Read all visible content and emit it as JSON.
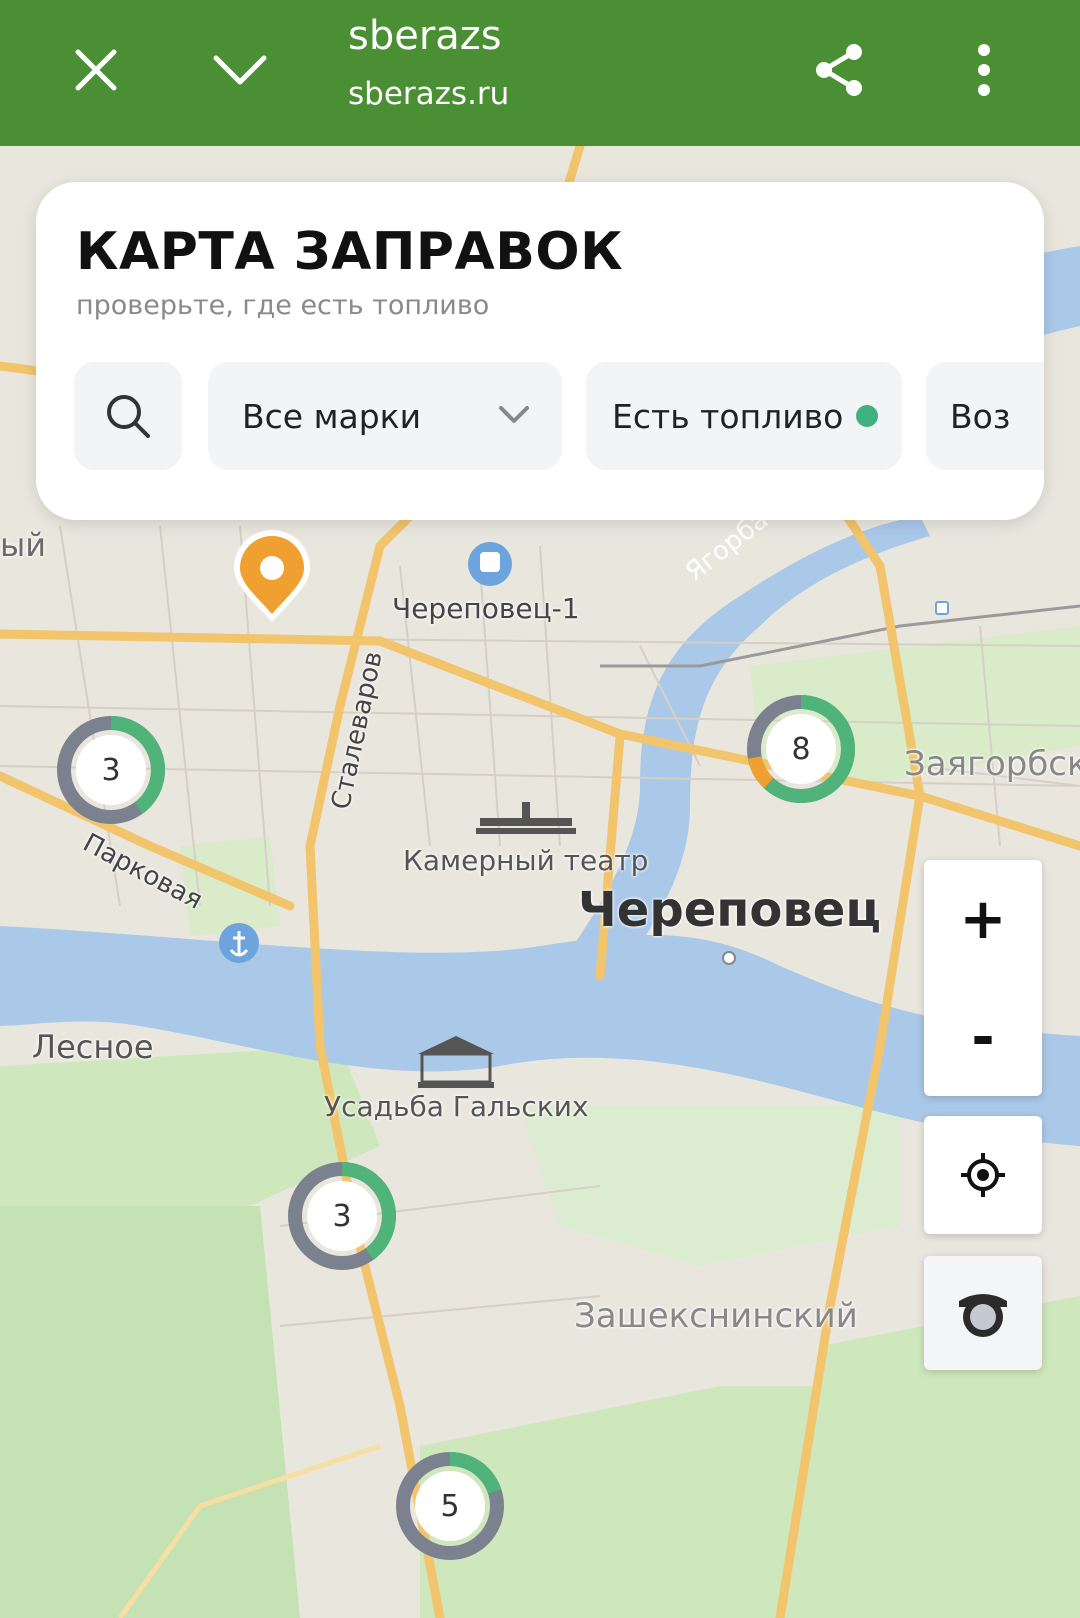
{
  "browser": {
    "title": "sberazs",
    "url": "sberazs.ru",
    "icons": [
      "close-icon",
      "chevron-down-icon",
      "share-icon",
      "more-vertical-icon"
    ]
  },
  "card": {
    "title": "КАРТА ЗАПРАВОК",
    "subtitle": "проверьте, где есть топливо",
    "brand_filter": "Все марки",
    "fuel_filter": "Есть топливо",
    "next_filter": "Воз"
  },
  "map": {
    "labels": {
      "station": "Череповец-1",
      "river": "Ягорба",
      "district_zayagorbsky": "Заягорбск",
      "street_stalevarov": "Сталеваров",
      "street_parkovaya": "Парковая",
      "theatre": "Камерный театр",
      "city": "Череповец",
      "lesnoe": "Лесное",
      "usadba": "Усадьба Гальских",
      "zasheksninsky": "Зашекснинский",
      "edge_left": "ый"
    },
    "clusters": [
      {
        "count": "3",
        "green_fraction": 0.4,
        "orange_fraction": 0.0
      },
      {
        "count": "8",
        "green_fraction": 0.62,
        "orange_fraction": 0.1
      },
      {
        "count": "3",
        "green_fraction": 0.4,
        "orange_fraction": 0.0
      },
      {
        "count": "5",
        "green_fraction": 0.2,
        "orange_fraction": 0.0
      }
    ]
  },
  "controls": {
    "zoom_in": "+",
    "zoom_out": "-"
  },
  "colors": {
    "brand_green": "#4a8f33",
    "cluster_green": "#4fb37a",
    "cluster_gray": "#7b818f",
    "cluster_orange": "#f0a030",
    "status_dot": "#3fb27f",
    "marker_orange": "#f0a030"
  }
}
